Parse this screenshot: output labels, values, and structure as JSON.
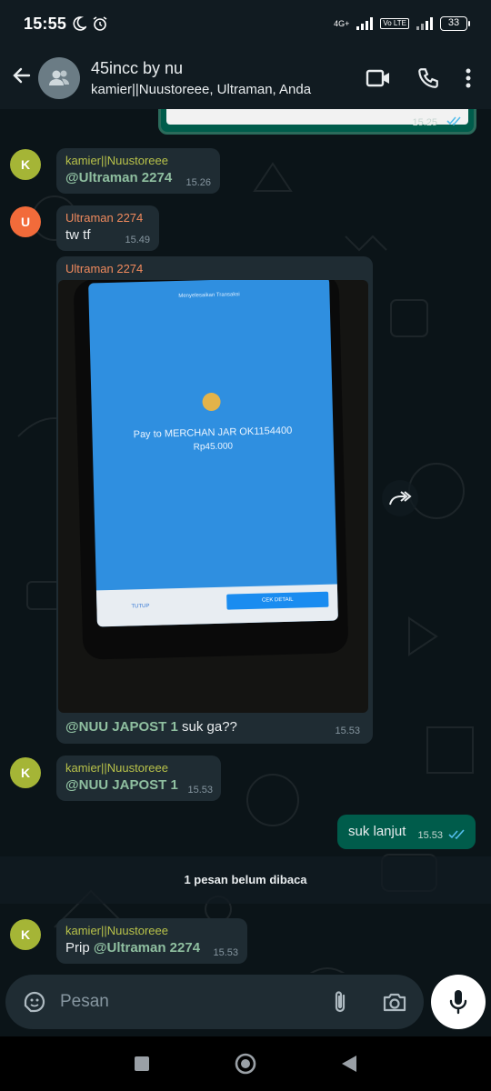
{
  "status_bar": {
    "time": "15:55",
    "network": "4G+",
    "lte": "Vo LTE",
    "battery": "33"
  },
  "header": {
    "title": "45incc by nu",
    "subtitle": "kamier||Nuustoreee, Ultraman, Anda"
  },
  "messages": [
    {
      "avatar": "K",
      "avatar_color": "#a5b536",
      "sender": "kamier||Nuustoreee",
      "sender_color": "#b8c24a",
      "mention": "@Ultraman 2274",
      "time": "15.26"
    },
    {
      "avatar": "U",
      "avatar_color": "#f26b3a",
      "sender": "Ultraman 2274",
      "sender_color": "#f08a5d",
      "text": "tw tf",
      "time": "15.49"
    },
    {
      "sender": "Ultraman 2274",
      "sender_color": "#f08a5d",
      "mention": "@NUU JAPOST 1",
      "text": "suk ga??",
      "time": "15.53",
      "image": {
        "small_header": "Menyelesaikan Transaksi",
        "pay_line": "Pay to MERCHAN JAR OK1154400",
        "amount": "Rp45.000",
        "button_left": "TUTUP",
        "button_right": "CEK DETAIL"
      }
    },
    {
      "avatar": "K",
      "avatar_color": "#a5b536",
      "sender": "kamier||Nuustoreee",
      "sender_color": "#b8c24a",
      "mention": "@NUU JAPOST 1",
      "time": "15.53"
    },
    {
      "outgoing": true,
      "text": "suk lanjut",
      "time": "15.53"
    },
    {
      "avatar": "K",
      "avatar_color": "#a5b536",
      "sender": "kamier||Nuustoreee",
      "sender_color": "#b8c24a",
      "text": "Prip",
      "mention": "@Ultraman 2274",
      "time": "15.53"
    }
  ],
  "earlier_outgoing_time": "15.25",
  "unread_banner": "1 pesan belum dibaca",
  "composer": {
    "placeholder": "Pesan"
  },
  "icons": [
    "moon-icon",
    "alarm-icon",
    "back-arrow-icon",
    "group-avatar-icon",
    "video-call-icon",
    "voice-call-icon",
    "more-options-icon",
    "forward-icon",
    "sticker-icon",
    "attach-icon",
    "camera-icon",
    "mic-icon",
    "nav-recents-icon",
    "nav-home-icon",
    "nav-back-icon"
  ]
}
